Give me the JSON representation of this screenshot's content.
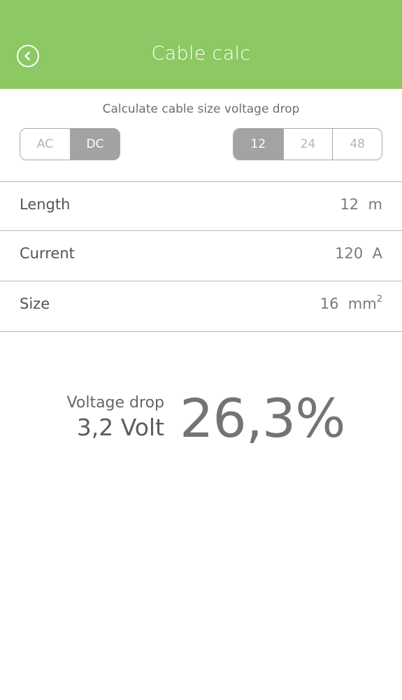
{
  "header": {
    "title": "Cable calc",
    "background_color": "#8cc863",
    "back_icon": "chevron-left-circle-icon"
  },
  "subtitle": "Calculate cable size voltage drop",
  "current_type": {
    "options": [
      "AC",
      "DC"
    ],
    "selected": "DC"
  },
  "system_voltage": {
    "options": [
      "12",
      "24",
      "48"
    ],
    "selected": "12"
  },
  "fields": [
    {
      "label": "Length",
      "value": "12",
      "unit": "m"
    },
    {
      "label": "Current",
      "value": "120",
      "unit": "A"
    },
    {
      "label": "Size",
      "value": "16",
      "unit": "mm",
      "unit_sup": "2"
    }
  ],
  "result": {
    "label": "Voltage drop",
    "volts": "3,2 Volt",
    "percent": "26,3%"
  }
}
